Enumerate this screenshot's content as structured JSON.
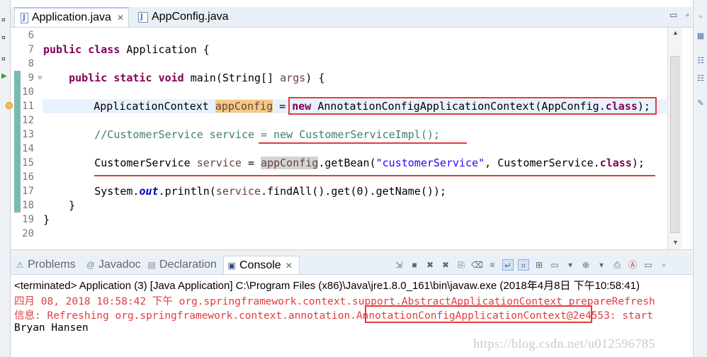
{
  "editor": {
    "tabs": [
      {
        "label": "Application.java",
        "active": true
      },
      {
        "label": "AppConfig.java",
        "active": false
      }
    ],
    "line_numbers": [
      "6",
      "7",
      "8",
      "9",
      "10",
      "11",
      "12",
      "13",
      "14",
      "15",
      "16",
      "17",
      "18",
      "19",
      "20"
    ],
    "code": {
      "l7_kw1": "public",
      "l7_kw2": "class",
      "l7_rest": " Application {",
      "l9_kw1": "public",
      "l9_kw2": "static",
      "l9_kw3": "void",
      "l9_a": " main(String[] ",
      "l9_param": "args",
      "l9_b": ") {",
      "l11_type": "ApplicationContext ",
      "l11_var": "appConfig",
      "l11_eq": " = ",
      "l11_new": "new",
      "l11_ctor": " AnnotationConfigApplicationContext(AppConfig.",
      "l11_class": "class",
      "l11_end": ");",
      "l13_comment": "//CustomerService service = new CustomerServiceImpl();",
      "l15_type": "CustomerService ",
      "l15_var": "service",
      "l15_eq": " = ",
      "l15_ref": "appConfig",
      "l15_call": ".getBean(",
      "l15_str": "\"customerService\"",
      "l15_mid": ", CustomerService.",
      "l15_class": "class",
      "l15_end": ");",
      "l17_a": "System.",
      "l17_out": "out",
      "l17_b": ".println(",
      "l17_var": "service",
      "l17_c": ".findAll().get(0).getName());",
      "l18": "    }",
      "l19": "}"
    }
  },
  "panel": {
    "tabs": [
      {
        "label": "Problems",
        "icon": "problems-icon"
      },
      {
        "label": "Javadoc",
        "icon": "javadoc-icon"
      },
      {
        "label": "Declaration",
        "icon": "declaration-icon"
      },
      {
        "label": "Console",
        "icon": "console-icon",
        "active": true
      }
    ]
  },
  "console": {
    "header": "<terminated> Application (3) [Java Application] C:\\Program Files (x86)\\Java\\jre1.8.0_161\\bin\\javaw.exe (2018年4月8日 下午10:58:41)",
    "line1": "四月 08, 2018 10:58:42 下午 org.springframework.context.support.AbstractApplicationContext prepareRefresh",
    "line2": "信息: Refreshing org.springframework.context.annotation.AnnotationConfigApplicationContext@2e4553: start",
    "line3": "Bryan Hansen"
  },
  "watermark": "https://blog.csdn.net/u012596785",
  "colors": {
    "keyword": "#7f0055",
    "comment": "#3f7f5f",
    "string": "#2a00ff",
    "error": "#e03c3c",
    "annotation_box": "#e03c3c"
  }
}
